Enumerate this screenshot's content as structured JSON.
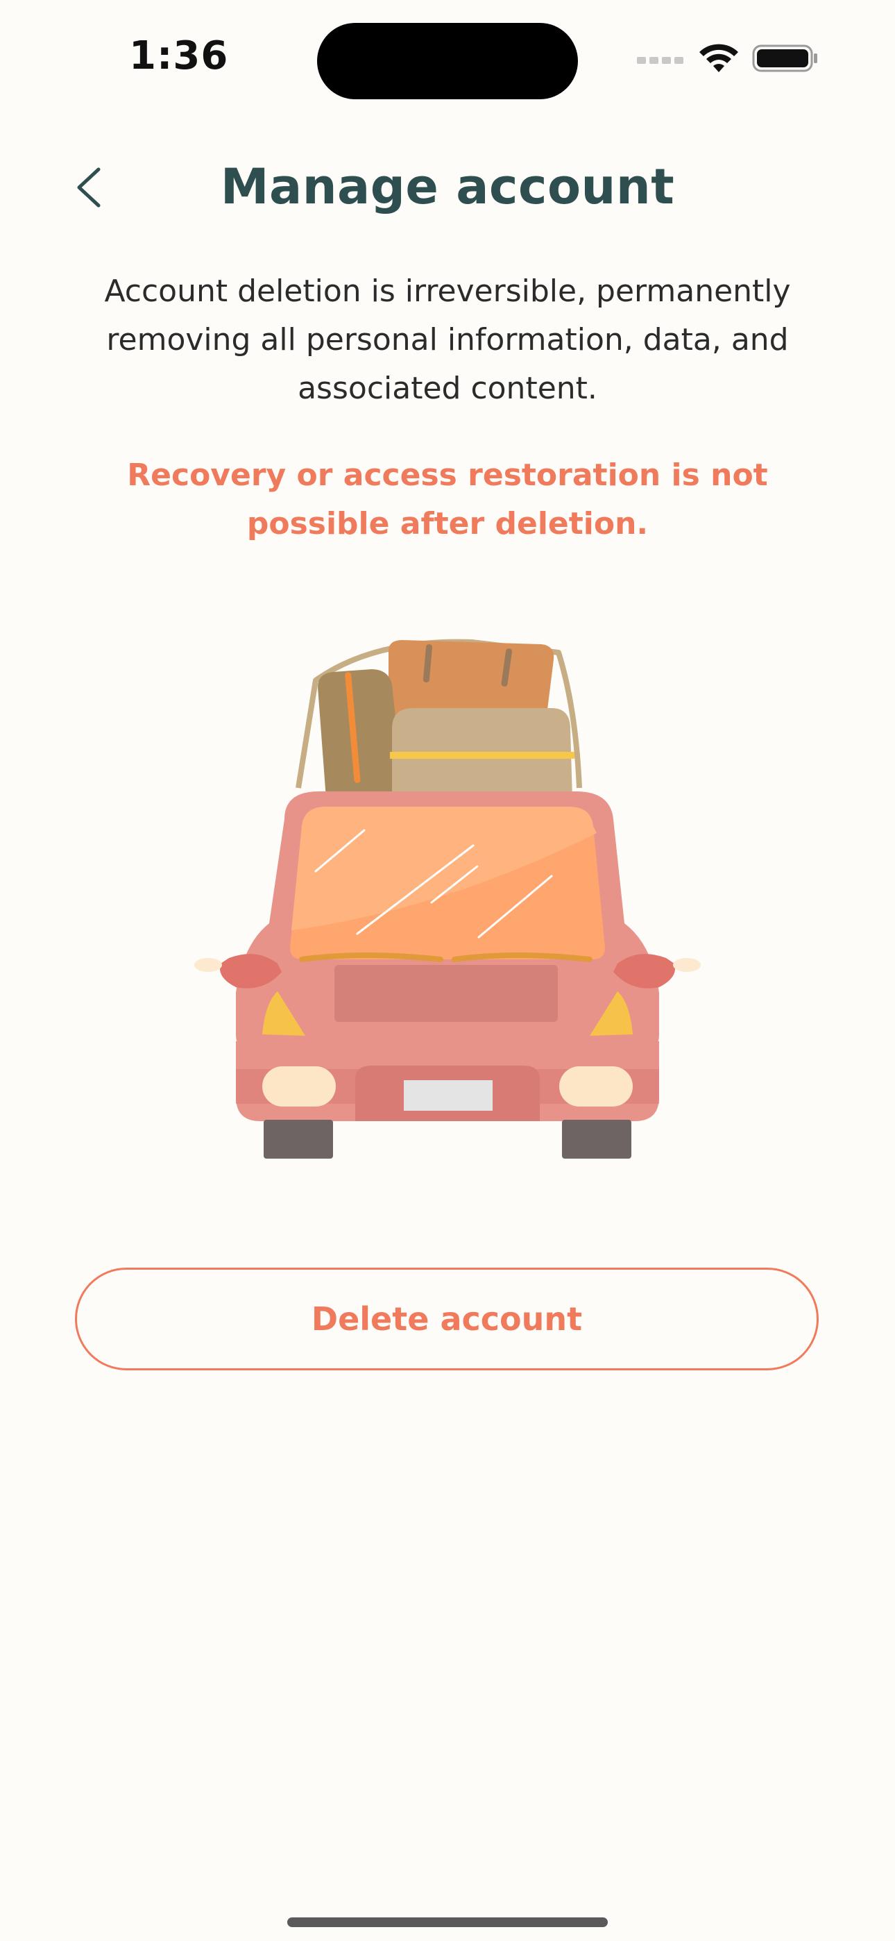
{
  "status_bar": {
    "time": "1:36"
  },
  "header": {
    "title": "Manage account",
    "back_icon": "chevron-left-icon"
  },
  "content": {
    "description": "Account deletion is irreversible, permanently removing all personal information, data, and associated content.",
    "warning": "Recovery or access restoration is not possible after deletion.",
    "illustration": "car-with-luggage"
  },
  "actions": {
    "delete_label": "Delete account"
  },
  "colors": {
    "background": "#FDFCF9",
    "title": "#2E4E4F",
    "accent": "#F07B5C",
    "body_text": "#2B2B2B"
  }
}
